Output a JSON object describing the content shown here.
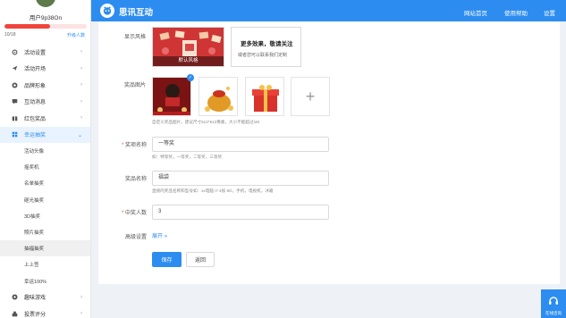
{
  "user": {
    "name": "用户9p38On",
    "progress_text": "10/18",
    "progress_ratio": 0.5556,
    "upgrade_label": "升级人数"
  },
  "sidebar": {
    "items": [
      {
        "label": "活动设置",
        "icon": "gear-icon"
      },
      {
        "label": "活动开场",
        "icon": "paper-plane-icon"
      },
      {
        "label": "品牌形象",
        "icon": "badge-icon"
      },
      {
        "label": "互动消息",
        "icon": "chat-icon"
      },
      {
        "label": "红包奖品",
        "icon": "gift-icon"
      },
      {
        "label": "幸运抽奖",
        "icon": "lottery-grid-icon"
      }
    ],
    "sub_items": [
      "活动头像",
      "摇奖机",
      "名单抽奖",
      "砸光抽奖",
      "3D抽奖",
      "照片抽奖",
      "抽福抽奖",
      "上上签",
      "幸运100%"
    ],
    "bottom_items": [
      {
        "label": "趣味游戏",
        "icon": "game-icon"
      },
      {
        "label": "投票评分",
        "icon": "vote-icon"
      }
    ]
  },
  "header": {
    "logo_text": "思讯互动",
    "nav": [
      "网站首页",
      "使用帮助",
      "设置"
    ]
  },
  "form": {
    "style_label": "显示风格",
    "style_card_label": "默认风格",
    "more_title": "更多效果，敬请关注",
    "more_sub": "或者您可以联系我们定制",
    "prize_image_label": "奖品图片",
    "prize_image_badge": "✓",
    "prize_image_hint": "自定义奖品图片，建议尺寸512*512像素，大小不能超过1M",
    "prize_level_label": "奖项名称",
    "prize_level_value": "一等奖",
    "prize_level_hint": "如：特等奖，一等奖，二等奖，三等奖",
    "prize_name_label": "奖品名称",
    "prize_name_value": "福袋",
    "prize_name_hint": "直接的奖品名称和型号如：xx电脑 i7 4核 8G，手机，电视机，冰箱",
    "winners_label": "中奖人数",
    "winners_value": "3",
    "advanced_label": "高级设置",
    "advanced_link": "展开",
    "save_label": "保存",
    "back_label": "返回"
  },
  "float_help": {
    "label": "在线咨询"
  },
  "colors": {
    "primary": "#2d8cf0",
    "danger": "#f0443c",
    "sidebar_active_bg": "#e8f3ff"
  }
}
